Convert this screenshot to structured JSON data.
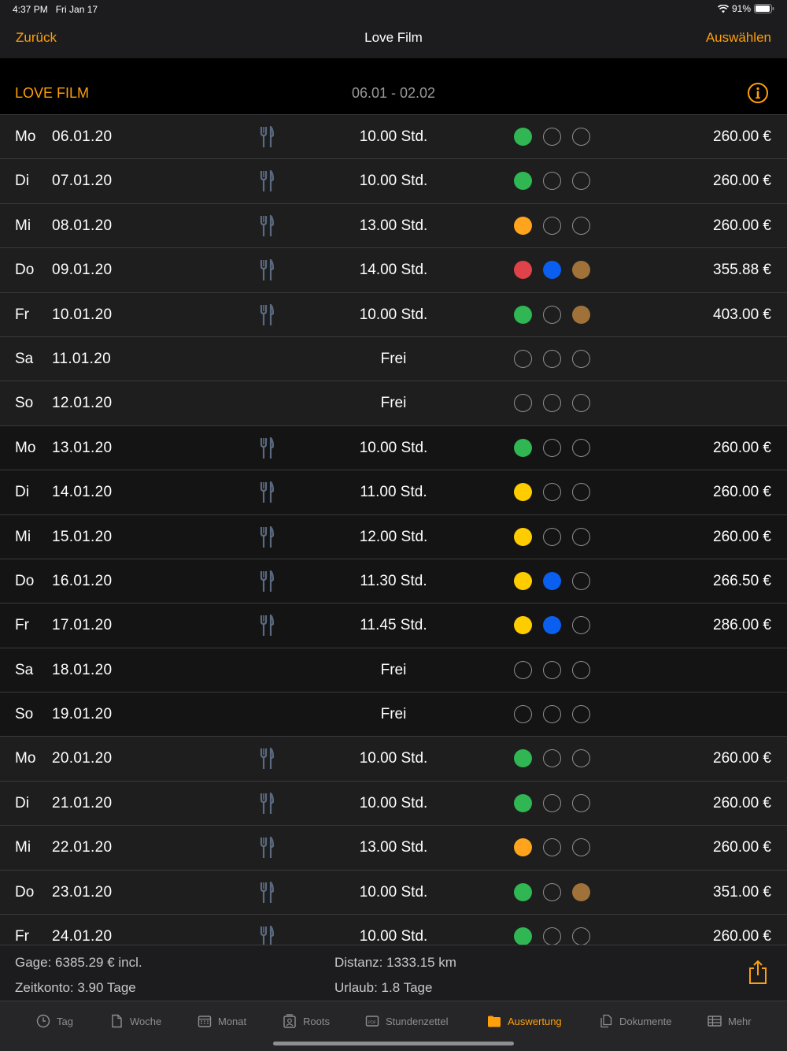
{
  "status": {
    "time": "4:37 PM",
    "date": "Fri Jan 17",
    "battery": "91%"
  },
  "nav": {
    "back": "Zurück",
    "title": "Love Film",
    "select": "Auswählen"
  },
  "section": {
    "project": "LOVE FILM",
    "range": "06.01 - 02.02"
  },
  "colors": {
    "accent": "#ff9f0a",
    "green": "#30b653",
    "orange": "#ffa41c",
    "yellow": "#ffcc00",
    "red": "#e0424a",
    "blue": "#0a5ef0",
    "brown": "#a0723a"
  },
  "rows": [
    {
      "day": "Mo",
      "date": "06.01.20",
      "meal": true,
      "hours": "10.00 Std.",
      "dots": [
        "green",
        "",
        ""
      ],
      "amount": "260.00 €",
      "week": 0
    },
    {
      "day": "Di",
      "date": "07.01.20",
      "meal": true,
      "hours": "10.00 Std.",
      "dots": [
        "green",
        "",
        ""
      ],
      "amount": "260.00 €",
      "week": 0
    },
    {
      "day": "Mi",
      "date": "08.01.20",
      "meal": true,
      "hours": "13.00 Std.",
      "dots": [
        "orange",
        "",
        ""
      ],
      "amount": "260.00 €",
      "week": 0
    },
    {
      "day": "Do",
      "date": "09.01.20",
      "meal": true,
      "hours": "14.00 Std.",
      "dots": [
        "red",
        "blue",
        "brown"
      ],
      "amount": "355.88 €",
      "week": 0
    },
    {
      "day": "Fr",
      "date": "10.01.20",
      "meal": true,
      "hours": "10.00 Std.",
      "dots": [
        "green",
        "",
        "brown"
      ],
      "amount": "403.00 €",
      "week": 0
    },
    {
      "day": "Sa",
      "date": "11.01.20",
      "meal": false,
      "hours": "Frei",
      "dots": [
        "",
        "",
        ""
      ],
      "amount": "",
      "week": 0
    },
    {
      "day": "So",
      "date": "12.01.20",
      "meal": false,
      "hours": "Frei",
      "dots": [
        "",
        "",
        ""
      ],
      "amount": "",
      "week": 0
    },
    {
      "day": "Mo",
      "date": "13.01.20",
      "meal": true,
      "hours": "10.00 Std.",
      "dots": [
        "green",
        "",
        ""
      ],
      "amount": "260.00 €",
      "week": 1
    },
    {
      "day": "Di",
      "date": "14.01.20",
      "meal": true,
      "hours": "11.00 Std.",
      "dots": [
        "yellow",
        "",
        ""
      ],
      "amount": "260.00 €",
      "week": 1
    },
    {
      "day": "Mi",
      "date": "15.01.20",
      "meal": true,
      "hours": "12.00 Std.",
      "dots": [
        "yellow",
        "",
        ""
      ],
      "amount": "260.00 €",
      "week": 1
    },
    {
      "day": "Do",
      "date": "16.01.20",
      "meal": true,
      "hours": "11.30 Std.",
      "dots": [
        "yellow",
        "blue",
        ""
      ],
      "amount": "266.50 €",
      "week": 1
    },
    {
      "day": "Fr",
      "date": "17.01.20",
      "meal": true,
      "hours": "11.45 Std.",
      "dots": [
        "yellow",
        "blue",
        ""
      ],
      "amount": "286.00 €",
      "week": 1
    },
    {
      "day": "Sa",
      "date": "18.01.20",
      "meal": false,
      "hours": "Frei",
      "dots": [
        "",
        "",
        ""
      ],
      "amount": "",
      "week": 1
    },
    {
      "day": "So",
      "date": "19.01.20",
      "meal": false,
      "hours": "Frei",
      "dots": [
        "",
        "",
        ""
      ],
      "amount": "",
      "week": 1
    },
    {
      "day": "Mo",
      "date": "20.01.20",
      "meal": true,
      "hours": "10.00 Std.",
      "dots": [
        "green",
        "",
        ""
      ],
      "amount": "260.00 €",
      "week": 0
    },
    {
      "day": "Di",
      "date": "21.01.20",
      "meal": true,
      "hours": "10.00 Std.",
      "dots": [
        "green",
        "",
        ""
      ],
      "amount": "260.00 €",
      "week": 0
    },
    {
      "day": "Mi",
      "date": "22.01.20",
      "meal": true,
      "hours": "13.00 Std.",
      "dots": [
        "orange",
        "",
        ""
      ],
      "amount": "260.00 €",
      "week": 0
    },
    {
      "day": "Do",
      "date": "23.01.20",
      "meal": true,
      "hours": "10.00 Std.",
      "dots": [
        "green",
        "",
        "brown"
      ],
      "amount": "351.00 €",
      "week": 0
    },
    {
      "day": "Fr",
      "date": "24.01.20",
      "meal": true,
      "hours": "10.00 Std.",
      "dots": [
        "green",
        "",
        ""
      ],
      "amount": "260.00 €",
      "week": 0
    }
  ],
  "summary": {
    "gage": "Gage: 6385.29 € incl.",
    "zeitkonto": "Zeitkonto: 3.90 Tage",
    "distanz": "Distanz: 1333.15 km",
    "urlaub": "Urlaub: 1.8 Tage"
  },
  "tabs": [
    {
      "label": "Tag",
      "icon": "clock-icon",
      "active": false
    },
    {
      "label": "Woche",
      "icon": "document-icon",
      "active": false
    },
    {
      "label": "Monat",
      "icon": "calendar-icon",
      "active": false
    },
    {
      "label": "Roots",
      "icon": "contacts-icon",
      "active": false
    },
    {
      "label": "Stundenzettel",
      "icon": "pdf-icon",
      "active": false
    },
    {
      "label": "Auswertung",
      "icon": "folder-icon",
      "active": true
    },
    {
      "label": "Dokumente",
      "icon": "documents-icon",
      "active": false
    },
    {
      "label": "Mehr",
      "icon": "table-icon",
      "active": false
    }
  ]
}
